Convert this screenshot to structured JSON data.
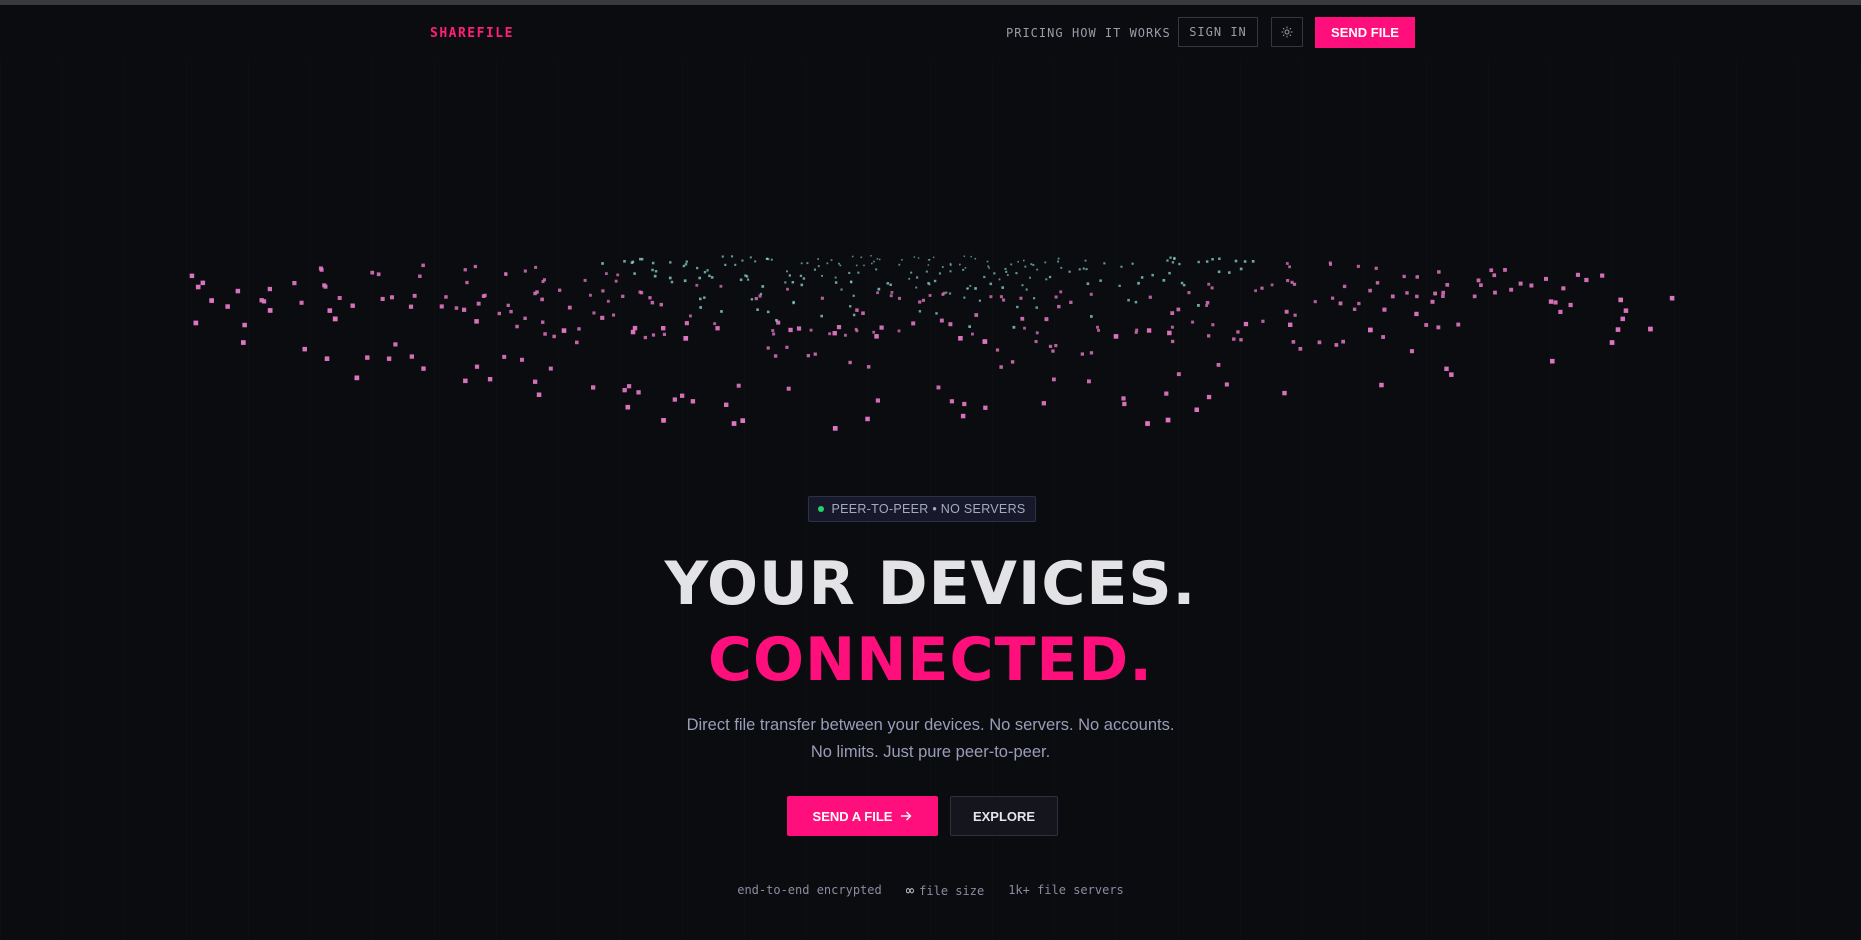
{
  "nav": {
    "logo": "SHAREFILE",
    "pricing": "PRICING",
    "how_it_works": "HOW IT WORKS",
    "sign_in": "SIGN IN",
    "theme_icon": "sun-icon",
    "send_file": "SEND FILE"
  },
  "hero": {
    "badge": "PEER-TO-PEER • NO SERVERS",
    "headline_line1": "YOUR DEVICES.",
    "headline_line2": "CONNECTED.",
    "subtitle_line1": "Direct file transfer between your devices. No servers. No accounts.",
    "subtitle_line2": "No limits. Just pure peer-to-peer.",
    "cta_primary": "SEND A FILE",
    "cta_primary_icon": "arrow-right-icon",
    "cta_secondary": "EXPLORE"
  },
  "stats": [
    {
      "symbol": "",
      "text": "end-to-end encrypted"
    },
    {
      "symbol": "∞",
      "text": "file size"
    },
    {
      "symbol": "",
      "text": "1k+ file servers"
    }
  ],
  "colors": {
    "background": "#0b0c10",
    "accent": "#ff0f7b",
    "particle_pink": "#e277c4",
    "particle_teal": "#8fe3d6",
    "badge_dot": "#22d36a"
  }
}
